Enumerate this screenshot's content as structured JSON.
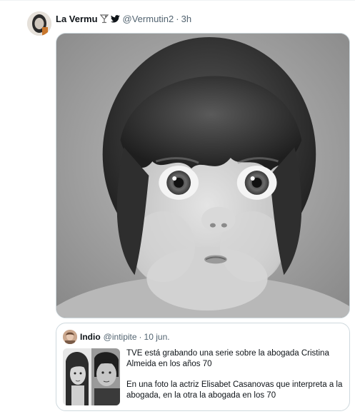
{
  "tweet": {
    "author_name": "La Vermu",
    "handle": "@Vermutin2",
    "separator": "·",
    "time": "3h",
    "icons": [
      "cocktail-icon",
      "twitter-bird-icon"
    ],
    "media_description": "black-and-white photo of a baby with bangs and puffed cheeks"
  },
  "quoted_tweet": {
    "author_name": "Indio",
    "handle": "@intipite",
    "separator": "·",
    "time": "10 jun.",
    "text_1": "TVE está grabando una serie sobre la abogada Cristina Almeida en los años 70",
    "text_2": "En una foto la actriz Elisabet Casanovas que interpreta a la abogada, en la otra la abogada en los 70"
  },
  "colors": {
    "text_primary": "#0f1419",
    "text_secondary": "#536471",
    "border": "#cfd9de",
    "twitter_blue": "#0f1419"
  }
}
